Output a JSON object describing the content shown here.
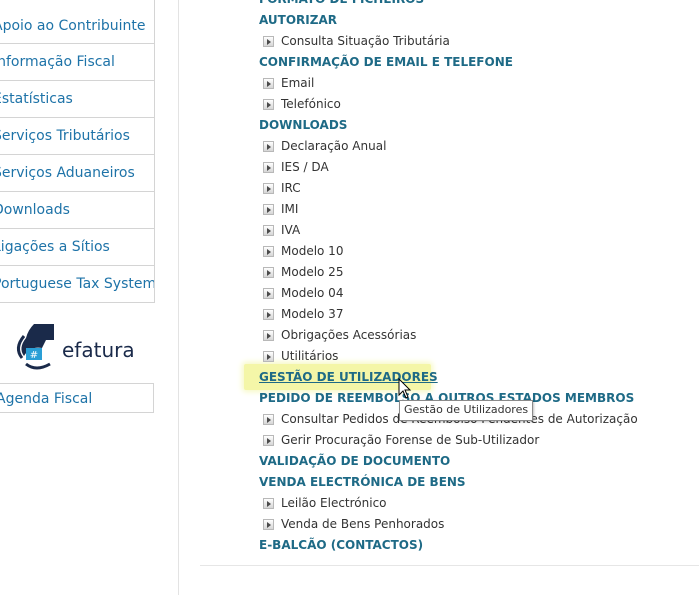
{
  "sidebar": {
    "items": [
      {
        "label": "Apoio ao Contribuinte"
      },
      {
        "label": "Informação Fiscal"
      },
      {
        "label": "Estatísticas"
      },
      {
        "label": "Serviços Tributários"
      },
      {
        "label": "Serviços Aduaneiros"
      },
      {
        "label": "Downloads"
      },
      {
        "label": "Ligações a Sítios"
      },
      {
        "label": "Portuguese Tax System"
      }
    ],
    "logo_text": "efatura",
    "agenda_label": "Agenda Fiscal"
  },
  "main": {
    "top_cut": "FORMATO DE FICHEIROS",
    "categories": {
      "autorizar": "AUTORIZAR",
      "confirmacao": "CONFIRMAÇÃO DE EMAIL E TELEFONE",
      "downloads": "DOWNLOADS",
      "gestao": "GESTÃO DE UTILIZADORES",
      "pedido": "PEDIDO DE REEMBOLSO A OUTROS ESTADOS MEMBROS",
      "validacao": "VALIDAÇÃO DE DOCUMENTO",
      "venda": "VENDA ELECTRÓNICA DE BENS",
      "ebalcao": "E-BALCÃO (CONTACTOS)"
    },
    "autorizar_items": [
      "Consulta Situação Tributária"
    ],
    "confirmacao_items": [
      "Email",
      "Telefónico"
    ],
    "downloads_items": [
      "Declaração Anual",
      "IES / DA",
      "IRC",
      "IMI",
      "IVA",
      "Modelo 10",
      "Modelo 25",
      "Modelo 04",
      "Modelo 37",
      "Obrigações Acessórias",
      "Utilitários"
    ],
    "pedido_items": [
      "Consultar Pedidos de Reembolso Pendentes de Autorização",
      "Gerir Procuração Forense de Sub-Utilizador"
    ],
    "venda_items": [
      "Leilão Electrónico",
      "Venda de Bens Penhorados"
    ]
  },
  "tooltip": "Gestão de Utilizadores",
  "colors": {
    "link": "#1e6a86",
    "highlight": "#f4f6a8",
    "sidebar_link": "#1e73a8"
  }
}
